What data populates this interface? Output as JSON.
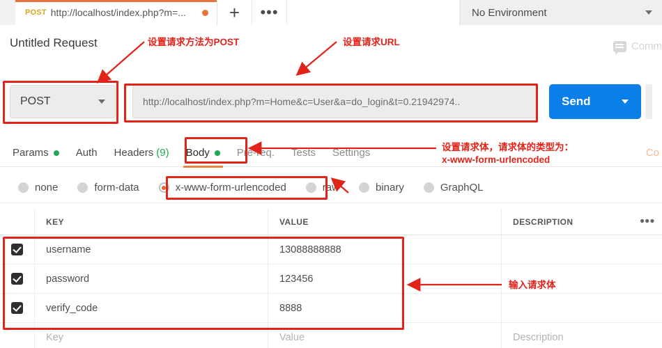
{
  "tabstrip": {
    "request_tab": {
      "method": "POST",
      "url": "http://localhost/index.php?m=...",
      "unsaved_indicator": "dot"
    },
    "new_tab_label": "+",
    "more_label": "•••",
    "environment": {
      "selected": "No Environment"
    }
  },
  "header": {
    "request_title": "Untitled Request",
    "comment_label": "Comm"
  },
  "url_bar": {
    "method": "POST",
    "url": "http://localhost/index.php?m=Home&c=User&a=do_login&t=0.21942974..",
    "send_label": "Send"
  },
  "section_tabs": [
    {
      "label": "Params",
      "dot": true,
      "count": "",
      "active": false,
      "muted": false
    },
    {
      "label": "Auth",
      "dot": false,
      "count": "",
      "active": false,
      "muted": false
    },
    {
      "label": "Headers",
      "dot": false,
      "count": "(9)",
      "active": false,
      "muted": false
    },
    {
      "label": "Body",
      "dot": true,
      "count": "",
      "active": true,
      "muted": false
    },
    {
      "label": "Pre-req.",
      "dot": false,
      "count": "",
      "active": false,
      "muted": true
    },
    {
      "label": "Tests",
      "dot": false,
      "count": "",
      "active": false,
      "muted": true
    },
    {
      "label": "Settings",
      "dot": false,
      "count": "",
      "active": false,
      "muted": true
    }
  ],
  "cookie_link": "Co",
  "body_types": [
    {
      "label": "none",
      "selected": false
    },
    {
      "label": "form-data",
      "selected": false
    },
    {
      "label": "x-www-form-urlencoded",
      "selected": true
    },
    {
      "label": "raw",
      "selected": false
    },
    {
      "label": "binary",
      "selected": false
    },
    {
      "label": "GraphQL",
      "selected": false
    }
  ],
  "table": {
    "columns": {
      "key": "KEY",
      "value": "VALUE",
      "description": "DESCRIPTION",
      "menu": "•••"
    },
    "rows": [
      {
        "checked": true,
        "key": "username",
        "value": "13088888888",
        "description": ""
      },
      {
        "checked": true,
        "key": "password",
        "value": "123456",
        "description": ""
      },
      {
        "checked": true,
        "key": "verify_code",
        "value": "8888",
        "description": ""
      }
    ],
    "placeholder_row": {
      "key": "Key",
      "value": "Value",
      "description": "Description"
    }
  },
  "annotations": [
    {
      "id": "method",
      "text": "设置请求方法为POST"
    },
    {
      "id": "url",
      "text": "设置请求URL"
    },
    {
      "id": "body",
      "text": "设置请求体，请求体的类型为：\nx-www-form-urlencoded"
    },
    {
      "id": "rows",
      "text": "输入请求体"
    }
  ],
  "colors": {
    "accent_orange": "#e8733d",
    "send_blue": "#0b7fe8",
    "annotation_red": "#e2231a",
    "status_green": "#1fa855"
  }
}
